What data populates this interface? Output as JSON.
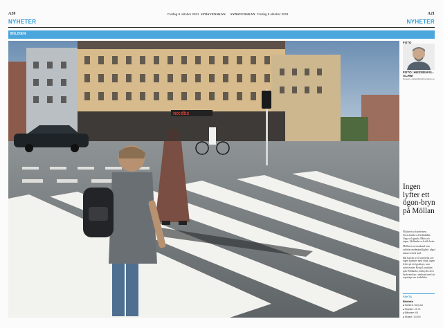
{
  "header": {
    "left_folio": "A20",
    "right_folio": "A21",
    "left_date": "Fredag 8 oktober 2021",
    "right_date": "Fredag 8 oktober 2021",
    "masthead": "SYDSVENSKAN"
  },
  "section": {
    "left": "NYHETER",
    "right": "NYHETER",
    "banner": "BILDEN"
  },
  "photo": {
    "label": "FOTO",
    "photographer": "FOTO: HUSSEIN EL-ALAWI",
    "email": "hussein.el-alawi@sydsvenskan.se",
    "shop_sign": "no:dbs"
  },
  "article": {
    "headline": "Ingen lyfter ett ögon-bryn på Möllan",
    "paragraphs": [
      "Flöjtisten och arbetaren. Stressfotade och lediklädda. Unga och gamla. Båda och ingen. Skillnader och olik-heter.",
      "Möllan är en marknad som rubriker medmänsklighet i något annan svensk stad.",
      "Här kan du se så som helst och ingen kommer med ofina, ingen lyfter på ett ögonbryn, som rubricerades Ronja Lomsätter, själv Möllanbo, härbrydes det i Sydsvenskan i samband med att reportage om stadsdelen."
    ]
  },
  "facts": {
    "title": "FAKTA",
    "subtitle": "Bildinfo",
    "items": [
      "Kamera: Sony A1",
      "Objektiv: 24-70",
      "Bländare: f/8",
      "Slutare: 1/1000"
    ]
  }
}
